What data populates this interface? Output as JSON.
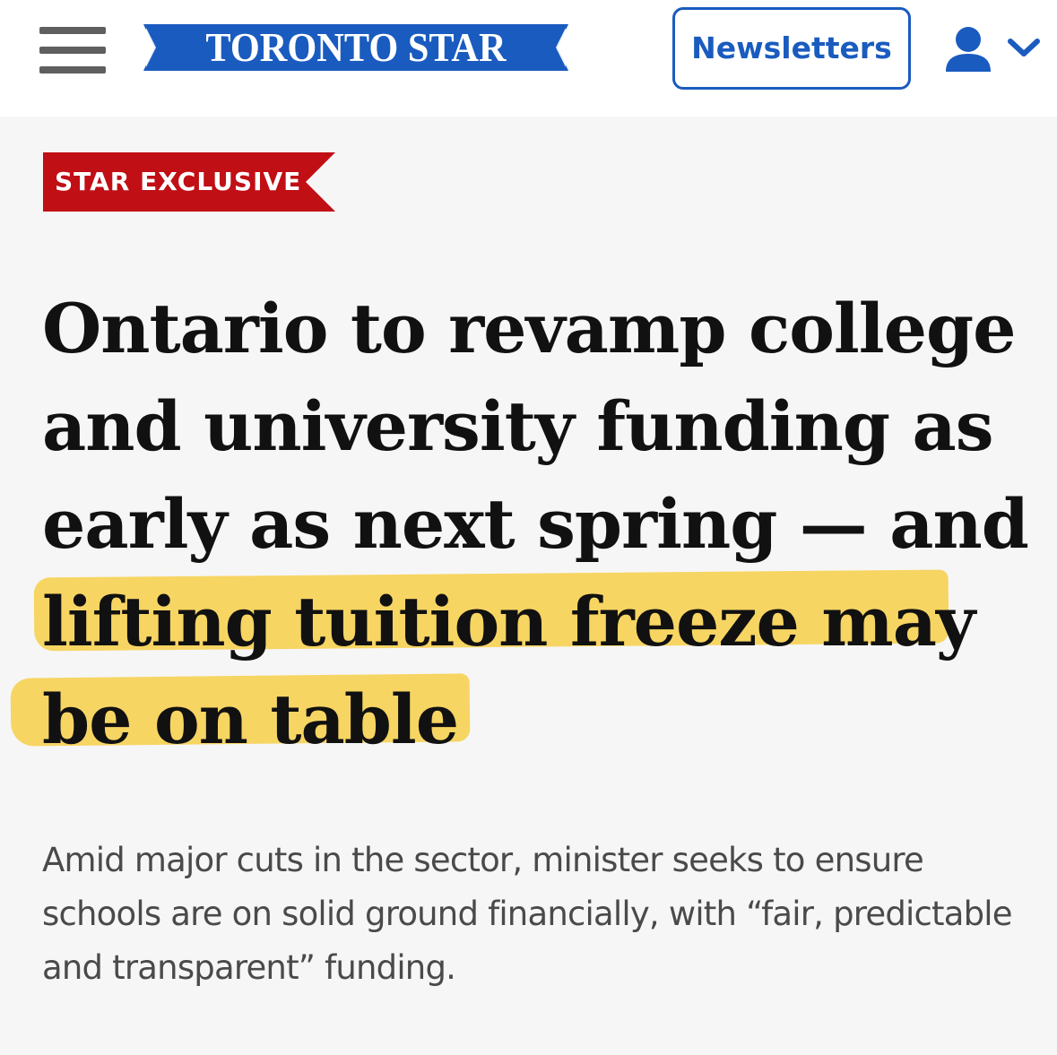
{
  "header": {
    "logo_text": "TORONTO STAR",
    "newsletters_label": "Newsletters"
  },
  "article": {
    "tag": "STAR EXCLUSIVE",
    "headline": "Ontario to revamp college and university funding as early as next spring — and lifting tuition freeze may be on table",
    "dek": "Amid major cuts in the sector, minister seeks to ensure schools are on solid ground financially, with “fair, predictable and transparent” funding."
  },
  "icons": {
    "menu": "hamburger-menu-icon",
    "user": "user-icon",
    "chevron": "chevron-down-icon"
  },
  "colors": {
    "brand_blue": "#1a5bbf",
    "tag_red": "#c00f15",
    "highlight_yellow": "#f7d253",
    "background": "#f6f6f6"
  }
}
